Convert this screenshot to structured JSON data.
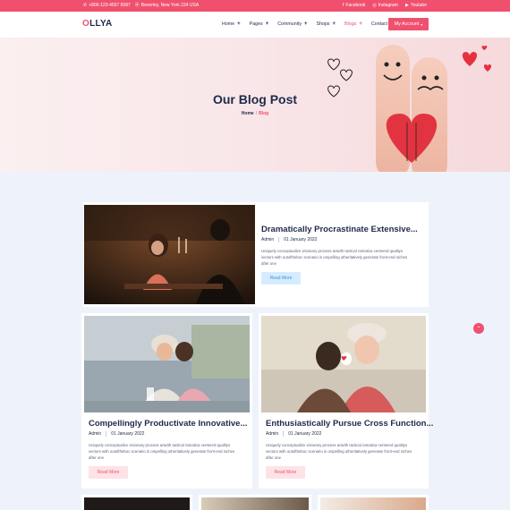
{
  "topbar": {
    "phone": "+800-123-4567 6587",
    "address": "Beverley, New York 224 USA",
    "social": [
      "Facebook",
      "Instagram",
      "Youtube"
    ]
  },
  "header": {
    "logo_accent": "O",
    "logo_rest": "LLYA",
    "nav": [
      "Home",
      "Pages",
      "Community",
      "Shops",
      "Blogs",
      "Contact"
    ],
    "nav_active": "Blogs",
    "account_label": "My Account"
  },
  "hero": {
    "title": "Our Blog Post",
    "breadcrumb_home": "Home",
    "breadcrumb_sep": "/",
    "breadcrumb_current": "Blog"
  },
  "posts": [
    {
      "title": "Dramatically Procrastinate Extensive...",
      "author": "Admin",
      "date": "01 January 2022",
      "excerpt": "Uniquely conceptualize visionary process ariwith tactical ramatica centered qualitys vectors with outoftheboc scenario is ompelling utheritatively generate front-end niches after one",
      "read_more": "Read More"
    },
    {
      "title": "Compellingly Productivate Innovative...",
      "author": "Admin",
      "date": "01 January 2022",
      "excerpt": "Uniquely conceptualize visionary process ariwith tactical ramatica centered qualitys vectors with outoftheboc scenario is ompelling utheritatively generate front-end niches after one",
      "read_more": "Read More"
    },
    {
      "title": "Enthusiastically Pursue Cross Function...",
      "author": "Admin",
      "date": "01 January 2022",
      "excerpt": "Uniquely conceptualize visionary process ariwith tactical ramatica centered qualitys vectors with outoftheboc scenario is ompelling utheritatively generate front-end niches after one",
      "read_more": "Read More"
    }
  ],
  "colors": {
    "accent": "#f0506e",
    "navy": "#1e2a4a",
    "page_bg": "#eef3fb"
  },
  "icons": [
    "phone-icon",
    "map-pin-icon",
    "facebook-icon",
    "instagram-icon",
    "youtube-icon",
    "chevron-up-icon"
  ]
}
